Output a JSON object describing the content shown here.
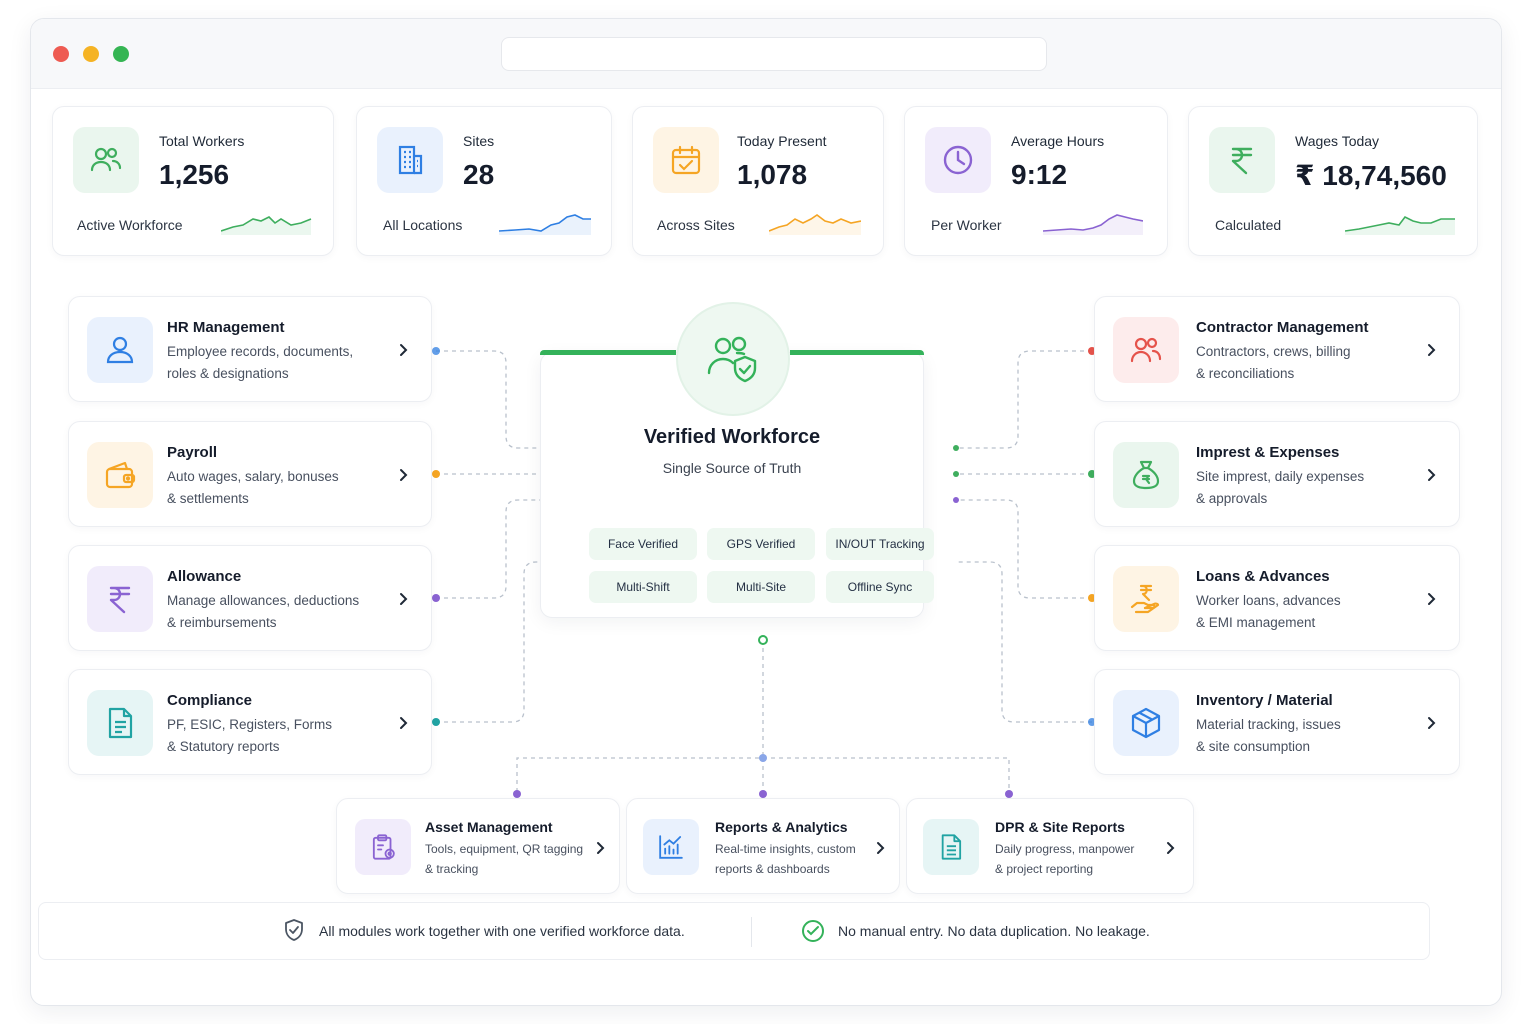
{
  "stats": [
    {
      "label": "Total Workers",
      "value": "1,256",
      "sub": "Active Workforce",
      "icon": "users-icon",
      "color": "#3fae5e"
    },
    {
      "label": "Sites",
      "value": "28",
      "sub": "All Locations",
      "icon": "building-icon",
      "color": "#2f7fe3"
    },
    {
      "label": "Today Present",
      "value": "1,078",
      "sub": "Across Sites",
      "icon": "calendar-check-icon",
      "color": "#f5a524"
    },
    {
      "label": "Average Hours",
      "value": "9:12",
      "sub": "Per Worker",
      "icon": "clock-icon",
      "color": "#8a63d2"
    },
    {
      "label": "Wages Today",
      "value": "₹ 18,74,560",
      "sub": "Calculated",
      "icon": "rupee-icon",
      "color": "#3fae5e"
    }
  ],
  "left_modules": [
    {
      "title": "HR Management",
      "desc1": "Employee records, documents,",
      "desc2": "roles & designations",
      "icon": "user-icon",
      "color": "#2f7fe3"
    },
    {
      "title": "Payroll",
      "desc1": "Auto wages, salary, bonuses",
      "desc2": "& settlements",
      "icon": "wallet-icon",
      "color": "#f5a524"
    },
    {
      "title": "Allowance",
      "desc1": "Manage allowances, deductions",
      "desc2": "& reimbursements",
      "icon": "rupee-icon",
      "color": "#8a63d2"
    },
    {
      "title": "Compliance",
      "desc1": "PF, ESIC, Registers, Forms",
      "desc2": "& Statutory reports",
      "icon": "document-icon",
      "color": "#21a3a3"
    }
  ],
  "right_modules": [
    {
      "title": "Contractor Management",
      "desc1": "Contractors, crews, billing",
      "desc2": "& reconciliations",
      "icon": "people-icon",
      "color": "#e5534b"
    },
    {
      "title": "Imprest & Expenses",
      "desc1": "Site imprest, daily expenses",
      "desc2": "& approvals",
      "icon": "money-bag-icon",
      "color": "#3fae5e"
    },
    {
      "title": "Loans & Advances",
      "desc1": "Worker loans, advances",
      "desc2": "& EMI management",
      "icon": "hand-coin-icon",
      "color": "#f5a524"
    },
    {
      "title": "Inventory / Material",
      "desc1": "Material tracking, issues",
      "desc2": "& site consumption",
      "icon": "box-icon",
      "color": "#2f7fe3"
    }
  ],
  "bottom_modules": [
    {
      "title": "Asset Management",
      "desc1": "Tools, equipment, QR tagging",
      "desc2": "& tracking",
      "icon": "clipboard-gear-icon",
      "color": "#8a63d2"
    },
    {
      "title": "Reports & Analytics",
      "desc1": "Real-time insights, custom",
      "desc2": "reports & dashboards",
      "icon": "bar-chart-icon",
      "color": "#2f7fe3"
    },
    {
      "title": "DPR & Site Reports",
      "desc1": "Daily progress, manpower",
      "desc2": "& project reporting",
      "icon": "file-report-icon",
      "color": "#21a3a3"
    }
  ],
  "center": {
    "title": "Verified Workforce",
    "subtitle": "Single Source of Truth",
    "features": [
      "Face Verified",
      "GPS Verified",
      "IN/OUT Tracking",
      "Multi-Shift",
      "Multi-Site",
      "Offline Sync"
    ],
    "icon": "user-shield-icon",
    "color": "#34b25a"
  },
  "footer": {
    "left": "All modules work together with one verified workforce data.",
    "right": "No manual entry. No data duplication. No leakage."
  }
}
